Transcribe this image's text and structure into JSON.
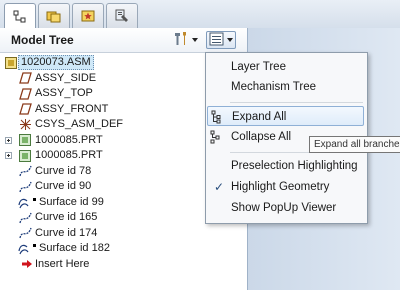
{
  "tabs": [
    {
      "icon": "model-tree-icon",
      "active": true
    },
    {
      "icon": "folder-browser-icon",
      "active": false
    },
    {
      "icon": "favorites-icon",
      "active": false
    },
    {
      "icon": "layer-tools-icon",
      "active": false
    }
  ],
  "panel": {
    "title": "Model Tree",
    "settings_icon": "tools-settings-icon",
    "show_icon": "show-menu-icon"
  },
  "tree": {
    "root": "1020073.ASM",
    "items": [
      {
        "label": "ASSY_SIDE",
        "icon": "datum-plane-icon"
      },
      {
        "label": "ASSY_TOP",
        "icon": "datum-plane-icon"
      },
      {
        "label": "ASSY_FRONT",
        "icon": "datum-plane-icon"
      },
      {
        "label": "CSYS_ASM_DEF",
        "icon": "coordinate-system-icon"
      },
      {
        "label": "1000085.PRT",
        "icon": "part-icon"
      },
      {
        "label": "1000085.PRT",
        "icon": "part-icon"
      },
      {
        "label": "Curve id 78",
        "icon": "curve-icon"
      },
      {
        "label": "Curve id 90",
        "icon": "curve-icon"
      },
      {
        "label": "Surface id 99",
        "icon": "surface-icon"
      },
      {
        "label": "Curve id 165",
        "icon": "curve-icon"
      },
      {
        "label": "Curve id 174",
        "icon": "curve-icon"
      },
      {
        "label": "Surface id 182",
        "icon": "surface-icon"
      },
      {
        "label": "Insert Here",
        "icon": "insert-arrow-icon"
      }
    ]
  },
  "menu": {
    "items": [
      {
        "label": "Layer Tree"
      },
      {
        "label": "Mechanism Tree"
      },
      {
        "label": "Expand  All",
        "icon": "expand-all-icon",
        "highlighted": true
      },
      {
        "label": "Collapse All",
        "icon": "collapse-all-icon"
      },
      {
        "label": "Preselection Highlighting"
      },
      {
        "label": "Highlight Geometry",
        "checked": true
      },
      {
        "label": "Show PopUp Viewer"
      }
    ]
  },
  "tooltip": "Expand all branches",
  "colors": {
    "selection": "#cfe8f8",
    "menu_hover": "#dfecfa",
    "insert_arrow": "#d0141c"
  }
}
